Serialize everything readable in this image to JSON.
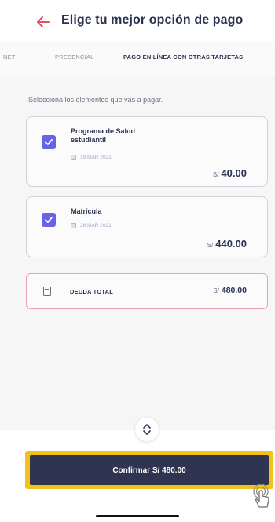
{
  "header": {
    "title": "Elige tu mejor opción de pago"
  },
  "tabs": [
    {
      "label": "NET"
    },
    {
      "label": "PRESENCIAL"
    },
    {
      "label": "PAGO EN LÍNEA CON OTRAS TARJETAS"
    }
  ],
  "instruction": "Selecciona los elementos que vas a pagar.",
  "items": [
    {
      "name": "Programa de Salud estudiantil",
      "date": "19 MAR 2021",
      "currency": "S/",
      "amount": "40.00",
      "checked": true
    },
    {
      "name": "Matrícula",
      "date": "26 MAR 2021",
      "currency": "S/",
      "amount": "440.00",
      "checked": true
    }
  ],
  "total": {
    "label": "DEUDA TOTAL",
    "currency": "S/",
    "amount": "480.00"
  },
  "confirm_label": "Confirmar S/ 480.00",
  "colors": {
    "accent": "#e84b67",
    "checkbox": "#6a62e4",
    "primary": "#2f3550",
    "highlight": "#f2c21b"
  }
}
